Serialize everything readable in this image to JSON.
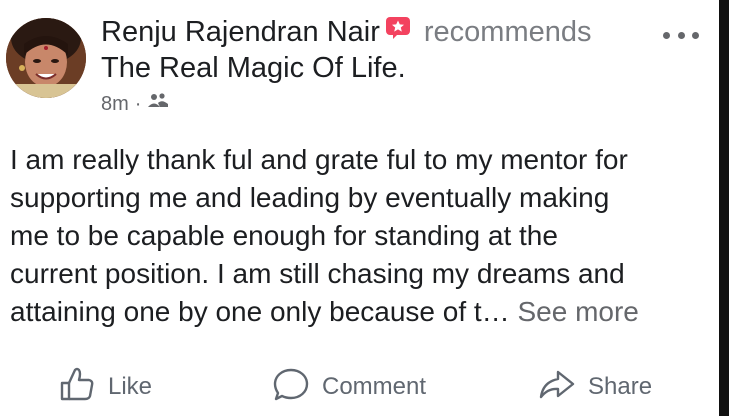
{
  "post": {
    "author": "Renju Rajendran Nair",
    "action_text": "recommends",
    "page_name": "The Real Magic Of Life.",
    "timestamp": "8m",
    "separator": "·",
    "body_lines": [
      "I am really thank ful and grate ful to my mentor for",
      "supporting me and leading by eventually making",
      "me to be capable enough for standing at the",
      "current position. I am still chasing my dreams and",
      "attaining one by one only because of t…"
    ],
    "see_more": "See more"
  },
  "actions": {
    "like": "Like",
    "comment": "Comment",
    "share": "Share"
  },
  "icons": {
    "badge": "recommendation-star-icon",
    "audience": "friends-audience-icon",
    "more": "more-options-icon",
    "like": "thumbs-up-icon",
    "comment": "comment-bubble-icon",
    "share": "share-arrow-icon"
  },
  "colors": {
    "text_primary": "#1c1e21",
    "text_secondary": "#65676b",
    "badge": "#f3425f"
  }
}
